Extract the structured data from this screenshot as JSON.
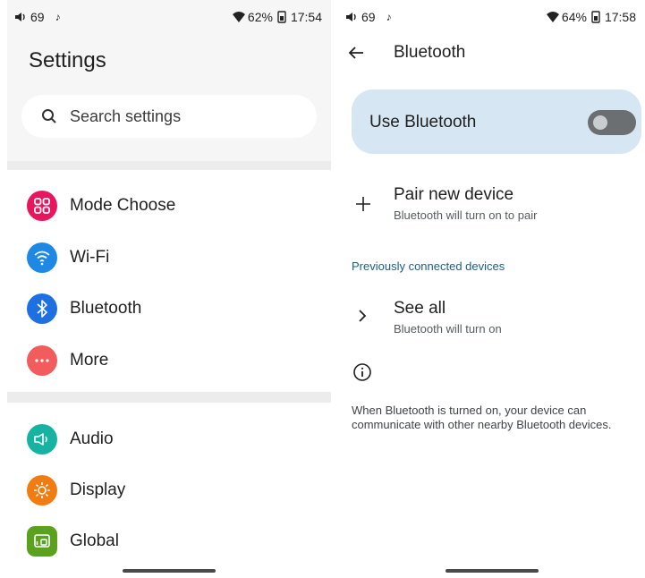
{
  "left_status": {
    "volume": "69",
    "music": "♪",
    "battery": "62%",
    "time": "17:54"
  },
  "right_status": {
    "volume": "69",
    "music": "♪",
    "battery": "64%",
    "time": "17:58"
  },
  "settings": {
    "title": "Settings",
    "search_placeholder": "Search settings",
    "group1": [
      {
        "label": "Mode Choose",
        "icon": "grid-icon",
        "color": "#e8165d"
      },
      {
        "label": "Wi-Fi",
        "icon": "wifi-icon",
        "color": "#1e88e5"
      },
      {
        "label": "Bluetooth",
        "icon": "bluetooth-icon",
        "color": "#1e6fe0"
      },
      {
        "label": "More",
        "icon": "more-dots-icon",
        "color": "#f25c5c"
      }
    ],
    "group2": [
      {
        "label": "Audio",
        "icon": "speaker-icon",
        "color": "#16b3a3"
      },
      {
        "label": "Display",
        "icon": "brightness-icon",
        "color": "#f07c12"
      },
      {
        "label": "Global",
        "icon": "globe-icon",
        "color": "#5aa21e"
      }
    ]
  },
  "bluetooth": {
    "title": "Bluetooth",
    "use_label": "Use Bluetooth",
    "toggle_on": false,
    "pair_title": "Pair new device",
    "pair_subtitle": "Bluetooth will turn on to pair",
    "previous_header": "Previously connected devices",
    "see_all_title": "See all",
    "see_all_subtitle": "Bluetooth will turn on",
    "info_text": "When Bluetooth is turned on, your device can communicate with other nearby Bluetooth devices."
  },
  "colors": {
    "card": "#d6e7f3",
    "accent_header": "#1a5f86"
  }
}
